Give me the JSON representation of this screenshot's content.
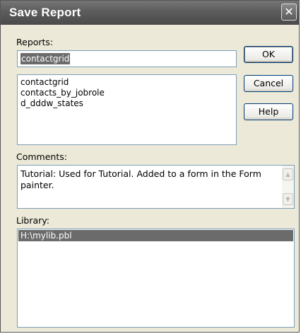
{
  "dialog": {
    "title": "Save Report",
    "close_glyph": "✕"
  },
  "reports": {
    "label": "Reports:",
    "input_value": "contactgrid",
    "items": [
      "contactgrid",
      "contacts_by_jobrole",
      "d_dddw_states"
    ]
  },
  "buttons": {
    "ok": "OK",
    "cancel": "Cancel",
    "help": "Help"
  },
  "comments": {
    "label": "Comments:",
    "text": "Tutorial: Used for Tutorial. Added to a form in the Form painter.",
    "scroll_up_icon": "scroll-up-arrow",
    "scroll_down_icon": "scroll-down-arrow"
  },
  "library": {
    "label": "Library:",
    "items": [
      "H:\\mylib.pbl"
    ],
    "selected_index": 0
  },
  "colors": {
    "dialog_bg": "#ece9d8",
    "selection_bg": "#6b6b6b",
    "field_border": "#7f9db9"
  }
}
